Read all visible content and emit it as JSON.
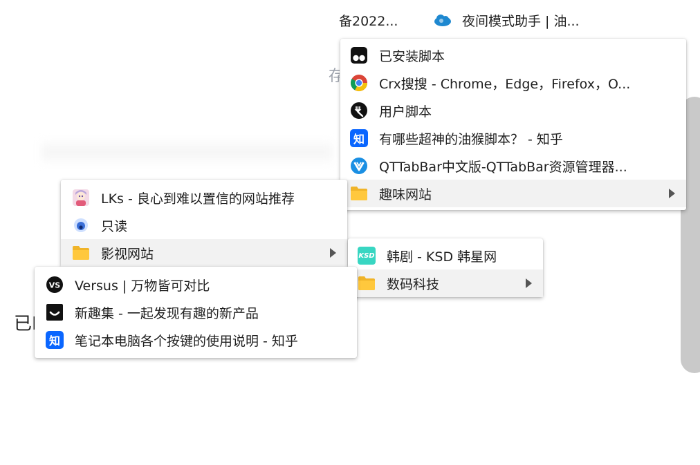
{
  "bookmarks_bar": {
    "item1": "备2022...",
    "item2": "夜间模式助手 | 油..."
  },
  "background": {
    "partial_glyph": "存",
    "partial_left_text": "已F"
  },
  "menu_level1": {
    "items": [
      {
        "label": "已安装脚本",
        "icon": "tampermonkey-icon"
      },
      {
        "label": "Crx搜搜 - Chrome，Edge，Firefox，O...",
        "icon": "chrome-icon"
      },
      {
        "label": "用户脚本",
        "icon": "greasyfork-icon"
      },
      {
        "label": "有哪些超神的油猴脚本？ - 知乎",
        "icon": "zhihu-icon"
      },
      {
        "label": "QTTabBar中文版-QTTabBar资源管理器...",
        "icon": "qttabbar-icon"
      },
      {
        "label": "趣味网站",
        "icon": "folder-icon",
        "submenu": true
      }
    ]
  },
  "menu_level2": {
    "items": [
      {
        "label": "LKs - 良心到难以置信的网站推荐",
        "icon": "anime-avatar-icon"
      },
      {
        "label": "只读",
        "icon": "blue-circle-icon"
      },
      {
        "label": "影视网站",
        "icon": "folder-icon",
        "submenu": true
      }
    ]
  },
  "menu_level3": {
    "items": [
      {
        "label": "韩剧 - KSD 韩星网",
        "icon": "ksd-icon",
        "icon_text": "KSD"
      },
      {
        "label": "数码科技",
        "icon": "folder-icon",
        "submenu": true
      }
    ]
  },
  "menu_level4": {
    "items": [
      {
        "label": "Versus | 万物皆可对比",
        "icon": "versus-icon",
        "icon_text": "VS"
      },
      {
        "label": "新趣集 - 一起发现有趣的新产品",
        "icon": "xinquji-icon"
      },
      {
        "label": "笔记本电脑各个按键的使用说明 - 知乎",
        "icon": "zhihu-icon",
        "icon_text": "知"
      }
    ]
  },
  "colors": {
    "folder": "#ffc83d",
    "zhihu": "#0a66ff",
    "ksd": "#38d6c2",
    "active_row": "#f2f2f2"
  }
}
